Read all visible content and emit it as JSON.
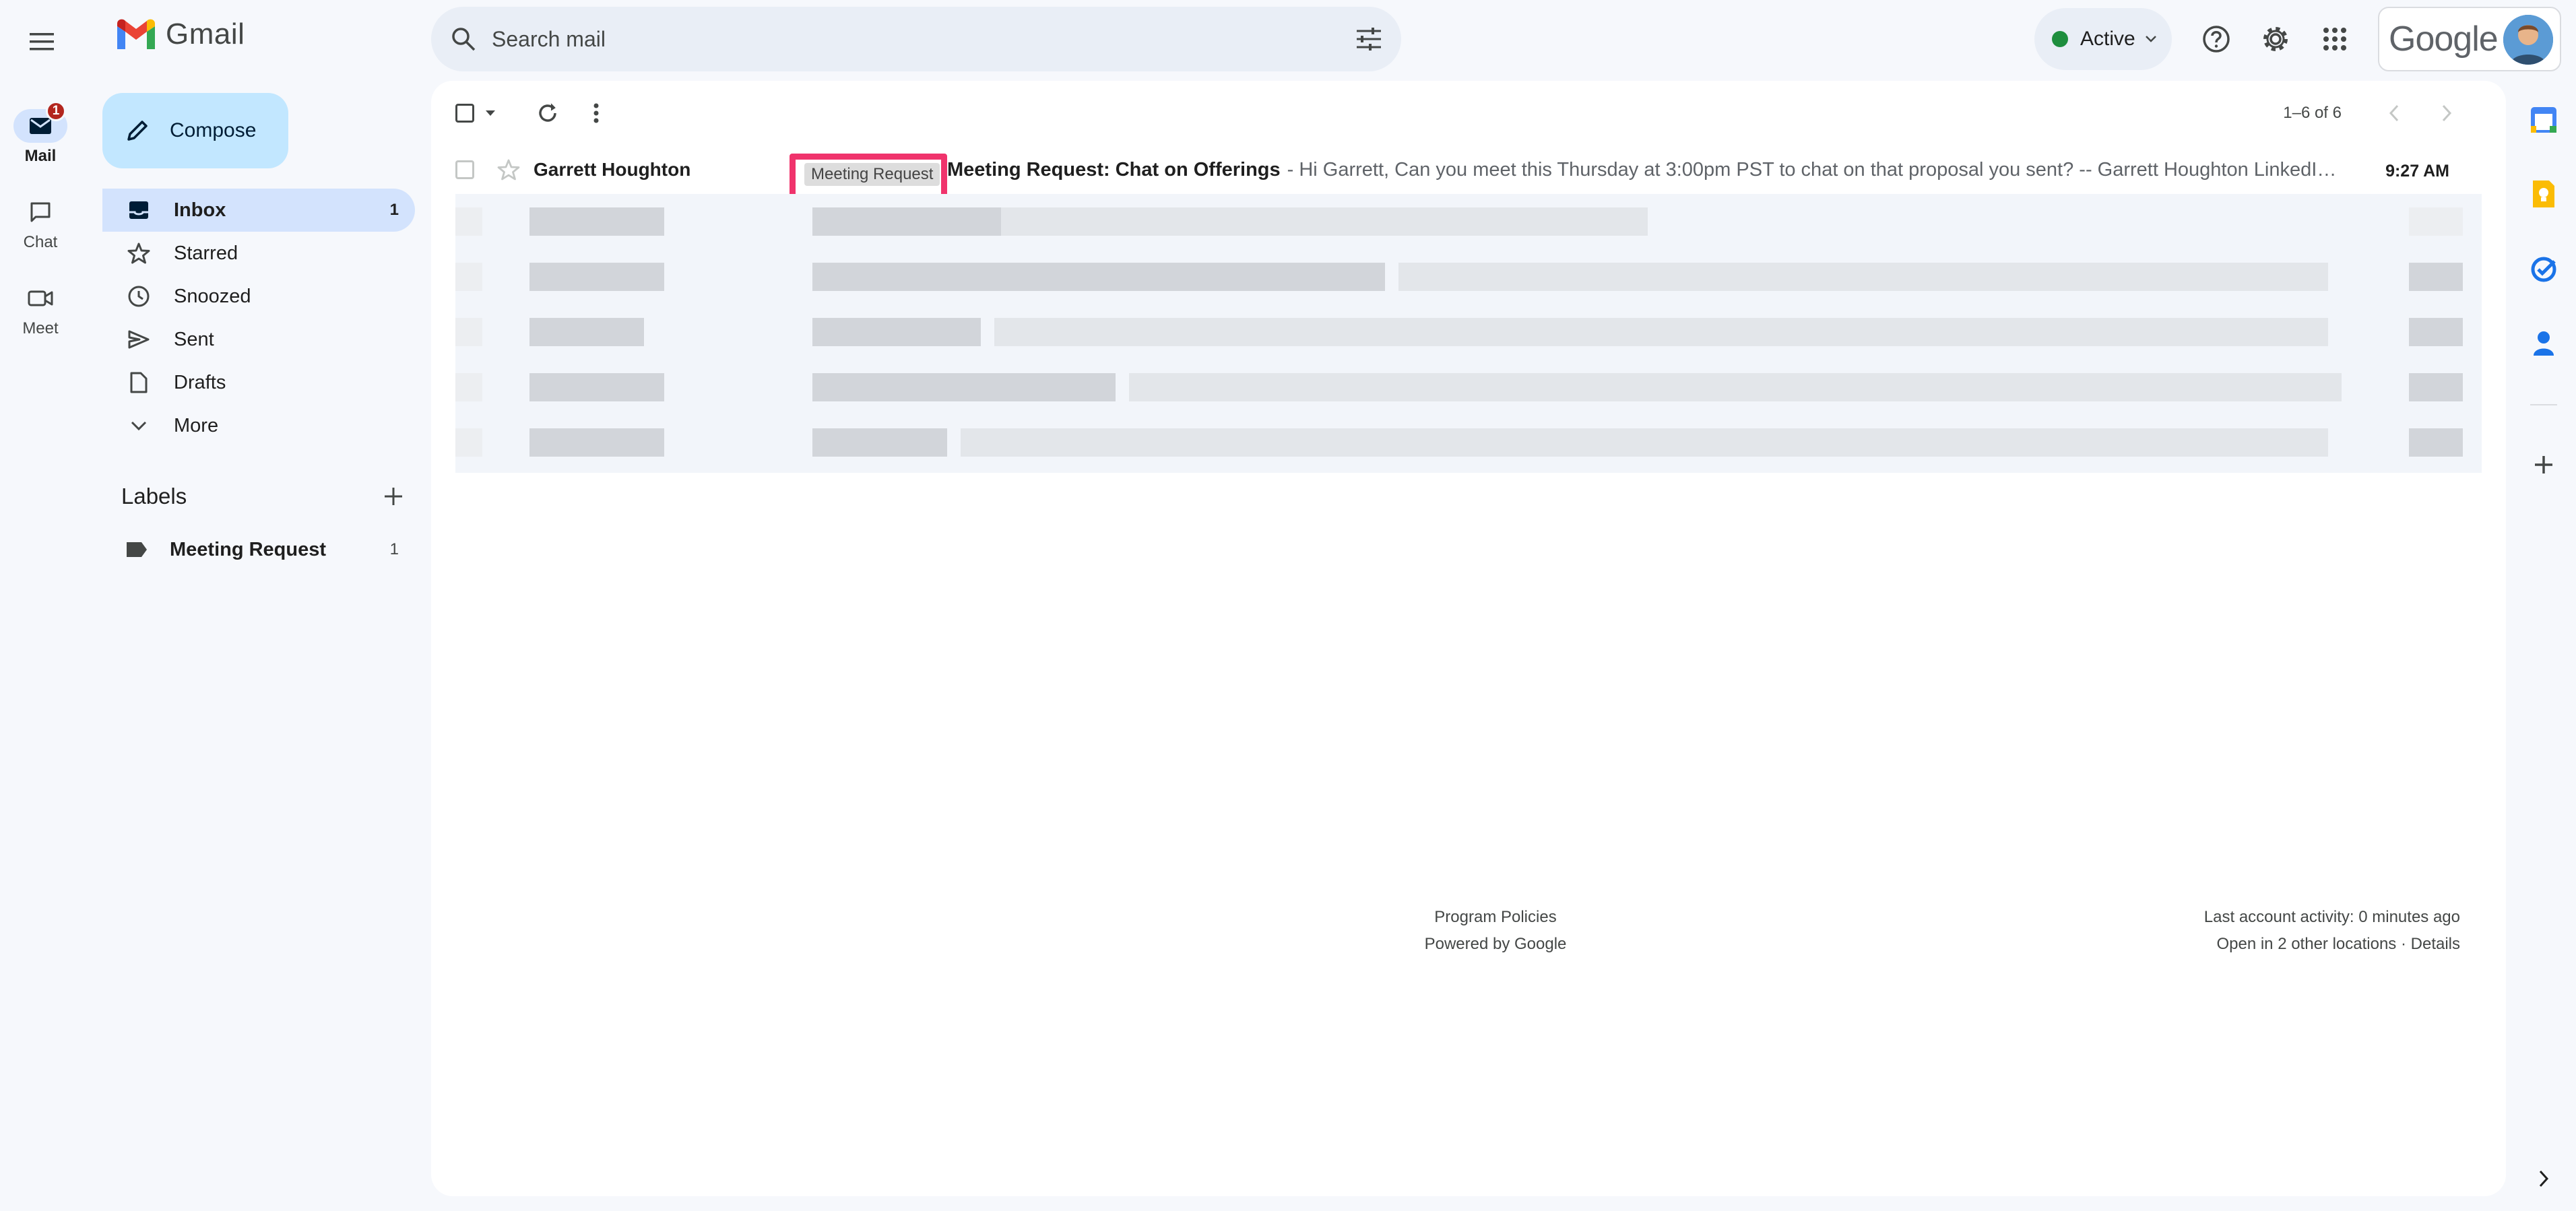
{
  "app": {
    "name": "Gmail"
  },
  "rail": {
    "mail_label": "Mail",
    "mail_badge": "1",
    "chat_label": "Chat",
    "meet_label": "Meet"
  },
  "compose": {
    "label": "Compose"
  },
  "nav": {
    "items": [
      {
        "label": "Inbox",
        "count": "1",
        "icon": "inbox-icon"
      },
      {
        "label": "Starred",
        "count": "",
        "icon": "star-icon"
      },
      {
        "label": "Snoozed",
        "count": "",
        "icon": "clock-icon"
      },
      {
        "label": "Sent",
        "count": "",
        "icon": "send-icon"
      },
      {
        "label": "Drafts",
        "count": "",
        "icon": "file-icon"
      },
      {
        "label": "More",
        "count": "",
        "icon": "chevron-down-icon"
      }
    ]
  },
  "labels": {
    "heading": "Labels",
    "items": [
      {
        "label": "Meeting Request",
        "count": "1"
      }
    ]
  },
  "search": {
    "placeholder": "Search mail"
  },
  "status": {
    "label": "Active",
    "color": "#1e8e3e"
  },
  "account": {
    "brand": "Google"
  },
  "toolbar": {
    "pager": "1–6 of 6"
  },
  "emails": [
    {
      "sender": "Garrett Houghton",
      "tag": "Meeting Request",
      "subject": "Meeting Request: Chat on Offerings",
      "snippet": "- Hi Garrett, Can you meet this Thursday at 3:00pm PST to chat on that proposal you sent? -- Garrett Houghton LinkedIn T...",
      "time": "9:27 AM"
    }
  ],
  "footer": {
    "program_policies": "Program Policies",
    "powered_by": "Powered by Google",
    "last_activity": "Last account activity: 0 minutes ago",
    "other_locations": "Open in 2 other locations · Details"
  },
  "colors": {
    "accent": "#0b57d0",
    "highlight": "#f0336c",
    "badge": "#b3261e",
    "nav_active": "#d3e3fd",
    "compose_bg": "#c2e7ff"
  }
}
